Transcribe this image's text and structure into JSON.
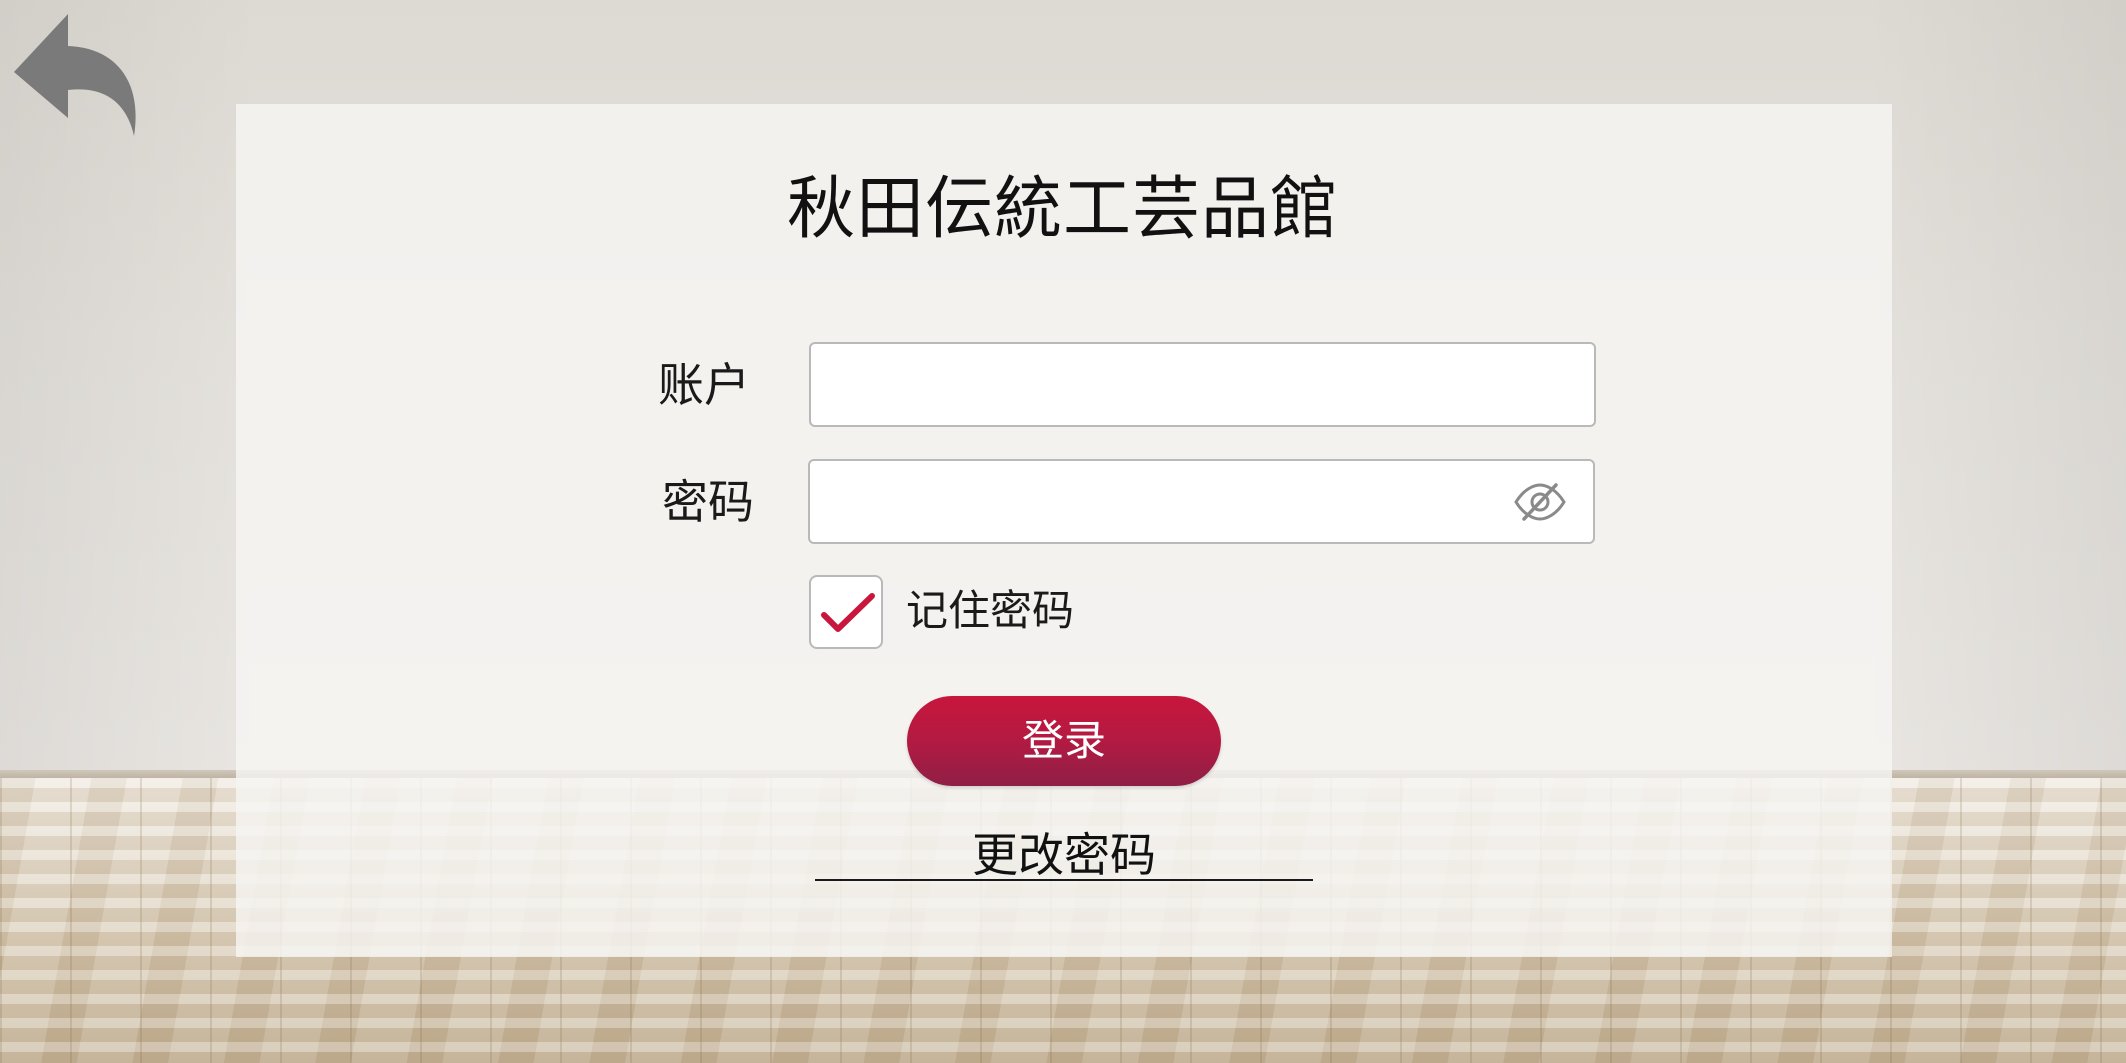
{
  "app": {
    "title": "秋田伝統工芸品館"
  },
  "nav": {
    "back_icon": "back-arrow-icon"
  },
  "form": {
    "account_label": "账户",
    "account_value": "",
    "password_label": "密码",
    "password_value": "",
    "password_toggle_icon": "eye-slash-icon",
    "remember_label": "记住密码",
    "remember_checked": true,
    "login_label": "登录",
    "change_password_label": "更改密码"
  },
  "colors": {
    "accent": "#c8163c",
    "accent_dark": "#8f1f46",
    "back_icon": "#7a7a7a"
  }
}
